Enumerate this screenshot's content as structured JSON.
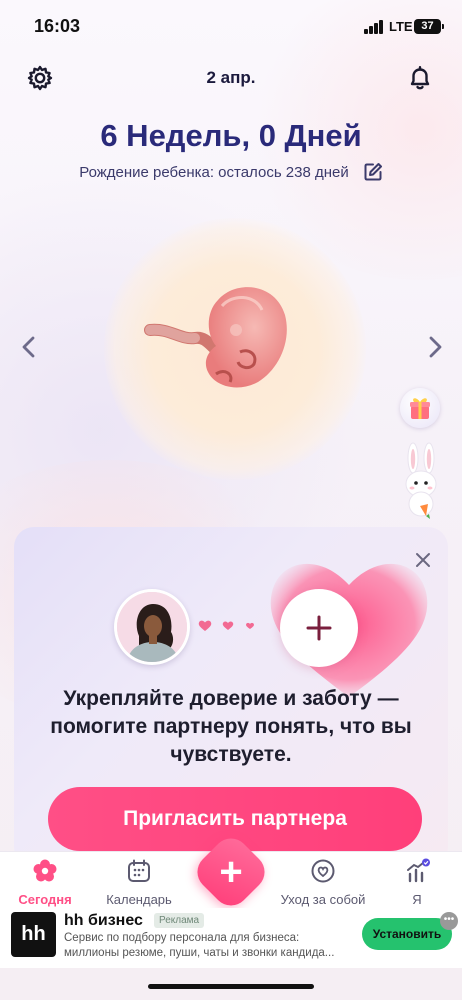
{
  "status_bar": {
    "time": "16:03",
    "network": "LTE",
    "battery": "37"
  },
  "header": {
    "date": "2 апр."
  },
  "pregnancy": {
    "week_title": "6 Недель, 0 Дней",
    "due_text": "Рождение ребенка: осталось 238 дней"
  },
  "partner_card": {
    "message": "Укрепляйте доверие и заботу — помогите партнеру понять, что вы чувствуете.",
    "invite_label": "Пригласить партнера"
  },
  "tabs": [
    {
      "label": "Сегодня",
      "icon": "flower-icon",
      "active": true
    },
    {
      "label": "Календарь",
      "icon": "calendar-icon",
      "active": false
    },
    {
      "label": "Уход за собой",
      "icon": "selfcare-icon",
      "active": false
    },
    {
      "label": "Я",
      "icon": "profile-chart-icon",
      "active": false
    }
  ],
  "ad": {
    "logo": "hh",
    "title": "hh бизнес",
    "badge": "Реклама",
    "description": "Сервис по подбору персонала для бизнеса: миллионы резюме, пуши, чаты и звонки кандида...",
    "install_label": "Установить"
  },
  "colors": {
    "accent": "#ff4f86",
    "title": "#2a2a7a",
    "install": "#25c26e"
  }
}
